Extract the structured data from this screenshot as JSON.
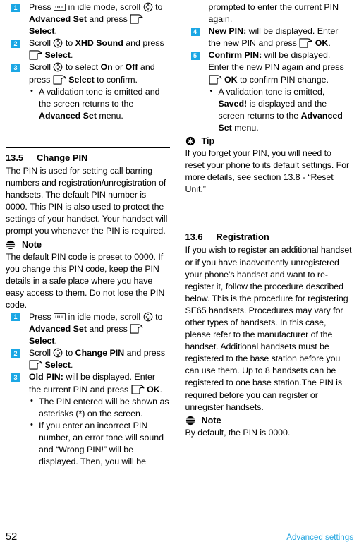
{
  "page": {
    "number": "52",
    "running_head": "Advanced settings",
    "accent_color": "#1CA7E4",
    "footer_link_color": "#22A5E0"
  },
  "icons": {
    "menu_key": "menu-key-icon",
    "navigation_key": "navigation-scroll-icon",
    "soft_key": "soft-key-icon",
    "note": "note-icon",
    "tip": "tip-icon"
  },
  "left_column": {
    "steps_top": [
      {
        "number": "1",
        "parts": [
          {
            "t": "text",
            "v": "Press "
          },
          {
            "t": "icon",
            "v": "menu_key"
          },
          {
            "t": "text",
            "v": " in idle mode, scroll "
          },
          {
            "t": "icon",
            "v": "navigation_key"
          },
          {
            "t": "text",
            "v": " to "
          },
          {
            "t": "bold",
            "v": "Advanced Set"
          },
          {
            "t": "text",
            "v": " and press "
          },
          {
            "t": "icon",
            "v": "soft_key"
          },
          {
            "t": "bold",
            "v": " Select"
          },
          {
            "t": "text",
            "v": "."
          }
        ]
      },
      {
        "number": "2",
        "parts": [
          {
            "t": "text",
            "v": "Scroll "
          },
          {
            "t": "icon",
            "v": "navigation_key"
          },
          {
            "t": "text",
            "v": " to "
          },
          {
            "t": "bold",
            "v": "XHD Sound"
          },
          {
            "t": "text",
            "v": " and press "
          },
          {
            "t": "icon",
            "v": "soft_key"
          },
          {
            "t": "bold",
            "v": " Select"
          },
          {
            "t": "text",
            "v": "."
          }
        ]
      },
      {
        "number": "3",
        "parts": [
          {
            "t": "text",
            "v": "Scroll "
          },
          {
            "t": "icon",
            "v": "navigation_key"
          },
          {
            "t": "text",
            "v": " to select "
          },
          {
            "t": "bold",
            "v": "On"
          },
          {
            "t": "text",
            "v": " or "
          },
          {
            "t": "bold",
            "v": "Off"
          },
          {
            "t": "text",
            "v": " and press "
          },
          {
            "t": "icon",
            "v": "soft_key"
          },
          {
            "t": "bold",
            "v": " Select"
          },
          {
            "t": "text",
            "v": " to confirm."
          }
        ],
        "bullets": [
          [
            {
              "t": "text",
              "v": "A validation tone is emitted and the screen returns to the "
            },
            {
              "t": "bold",
              "v": "Advanced Set"
            },
            {
              "t": "text",
              "v": " menu."
            }
          ]
        ]
      }
    ],
    "section": {
      "number": "13.5",
      "title": "Change PIN",
      "intro": "The PIN is used for setting call barring numbers and registration/unregistration of handsets. The default PIN number is 0000. This PIN is also used to protect the settings of your handset. Your handset will prompt you whenever the PIN is required.",
      "note_label": "Note",
      "note_text": "The default PIN code is preset to 0000. If you change this PIN code, keep the PIN details in a safe place where you have easy access to them. Do not lose the PIN code."
    },
    "steps_bottom": [
      {
        "number": "1",
        "parts": [
          {
            "t": "text",
            "v": "Press "
          },
          {
            "t": "icon",
            "v": "menu_key"
          },
          {
            "t": "text",
            "v": " in idle mode, scroll "
          },
          {
            "t": "icon",
            "v": "navigation_key"
          },
          {
            "t": "text",
            "v": " to "
          },
          {
            "t": "bold",
            "v": "Advanced Set"
          },
          {
            "t": "text",
            "v": " and press "
          },
          {
            "t": "icon",
            "v": "soft_key"
          },
          {
            "t": "bold",
            "v": " Select"
          },
          {
            "t": "text",
            "v": "."
          }
        ]
      },
      {
        "number": "2",
        "parts": [
          {
            "t": "text",
            "v": "Scroll "
          },
          {
            "t": "icon",
            "v": "navigation_key"
          },
          {
            "t": "text",
            "v": " to "
          },
          {
            "t": "bold",
            "v": "Change PIN"
          },
          {
            "t": "text",
            "v": " and press "
          },
          {
            "t": "icon",
            "v": "soft_key"
          },
          {
            "t": "bold",
            "v": " Select"
          },
          {
            "t": "text",
            "v": "."
          }
        ]
      },
      {
        "number": "3",
        "parts": [
          {
            "t": "bold",
            "v": "Old PIN:"
          },
          {
            "t": "text",
            "v": " will be displayed. Enter the current PIN and press "
          },
          {
            "t": "icon",
            "v": "soft_key"
          },
          {
            "t": "bold",
            "v": " OK"
          },
          {
            "t": "text",
            "v": "."
          }
        ],
        "bullets": [
          [
            {
              "t": "text",
              "v": "The PIN entered will be shown as asterisks (*) on the screen."
            }
          ],
          [
            {
              "t": "text",
              "v": "If you enter an incorrect PIN number, an error tone will sound and “Wrong PIN!” will be displayed. Then, you will be"
            }
          ]
        ]
      }
    ]
  },
  "right_column": {
    "continuation": "prompted to enter the current PIN again.",
    "steps": [
      {
        "number": "4",
        "parts": [
          {
            "t": "bold",
            "v": "New PIN:"
          },
          {
            "t": "text",
            "v": " will be displayed. Enter the new PIN and press "
          },
          {
            "t": "icon",
            "v": "soft_key"
          },
          {
            "t": "bold",
            "v": " OK"
          },
          {
            "t": "text",
            "v": "."
          }
        ]
      },
      {
        "number": "5",
        "parts": [
          {
            "t": "bold",
            "v": "Confirm PIN:"
          },
          {
            "t": "text",
            "v": " will be displayed. Enter the new PIN again and press "
          },
          {
            "t": "icon",
            "v": "soft_key"
          },
          {
            "t": "bold",
            "v": " OK"
          },
          {
            "t": "text",
            "v": " to confirm PIN change."
          }
        ],
        "bullets": [
          [
            {
              "t": "text",
              "v": "A validation tone is emitted, "
            },
            {
              "t": "bold",
              "v": "Saved!"
            },
            {
              "t": "text",
              "v": " is displayed and the screen returns to the "
            },
            {
              "t": "bold",
              "v": "Advanced Set"
            },
            {
              "t": "text",
              "v": " menu."
            }
          ]
        ]
      }
    ],
    "tip_label": "Tip",
    "tip_text": "If you forget your PIN, you will need to reset your phone to its default settings. For more details, see section 13.8 - “Reset Unit.”",
    "section": {
      "number": "13.6",
      "title": "Registration",
      "intro": "If you wish to register an additional handset or if you have inadvertently unregistered your phone's handset and want to re-register it, follow the procedure described below. This is the procedure for registering SE65 handsets. Procedures may vary for other types of handsets. In this case, please refer to the manufacturer of the handset. Additional handsets must be registered to the base station before you can use them. Up to 8 handsets can be registered to one base station.The PIN is required before you can register or unregister handsets.",
      "note_label": "Note",
      "note_text": "By default, the PIN is 0000."
    }
  }
}
